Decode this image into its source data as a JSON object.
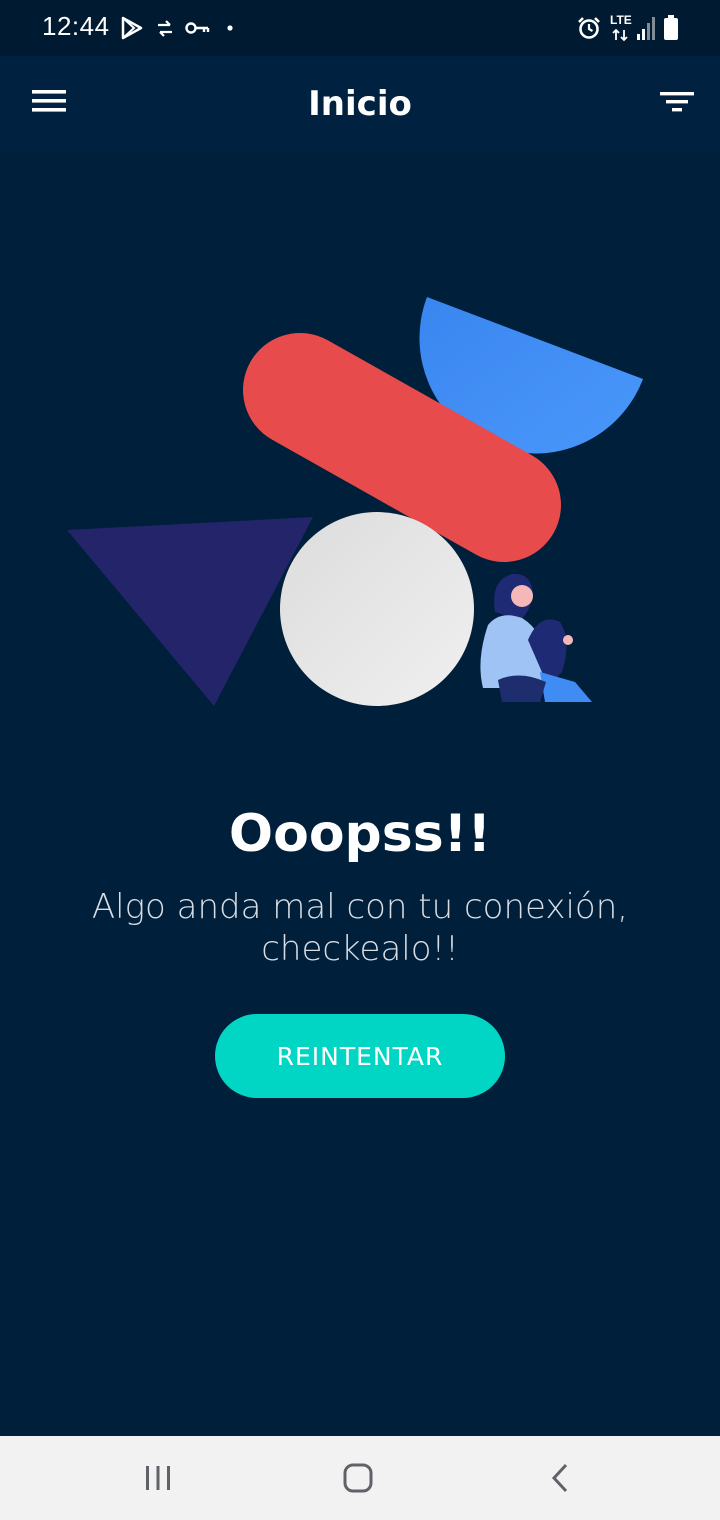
{
  "status_bar": {
    "time": "12:44",
    "network_label": "LTE",
    "icons": [
      "play-store-icon",
      "transfer-icon",
      "vpn-key-icon",
      "dot-icon",
      "alarm-icon",
      "lte-icon",
      "signal-icon",
      "battery-icon"
    ]
  },
  "app_bar": {
    "title": "Inicio",
    "menu_icon": "hamburger-menu-icon",
    "filter_icon": "filter-icon"
  },
  "error": {
    "title": "Ooopss!!",
    "message": "Algo anda mal con tu conexión, checkealo!!",
    "retry_label": "REINTENTAR"
  },
  "nav_bar": {
    "icons": [
      "recent-apps-icon",
      "home-icon",
      "back-icon"
    ]
  },
  "colors": {
    "background": "#001f3a",
    "app_bar": "#002240",
    "accent": "#00d6c3",
    "red_shape": "#e84b4b",
    "blue_shape": "#3f8cf5",
    "triangle": "#23246a",
    "circle": "#e6e6e6"
  }
}
